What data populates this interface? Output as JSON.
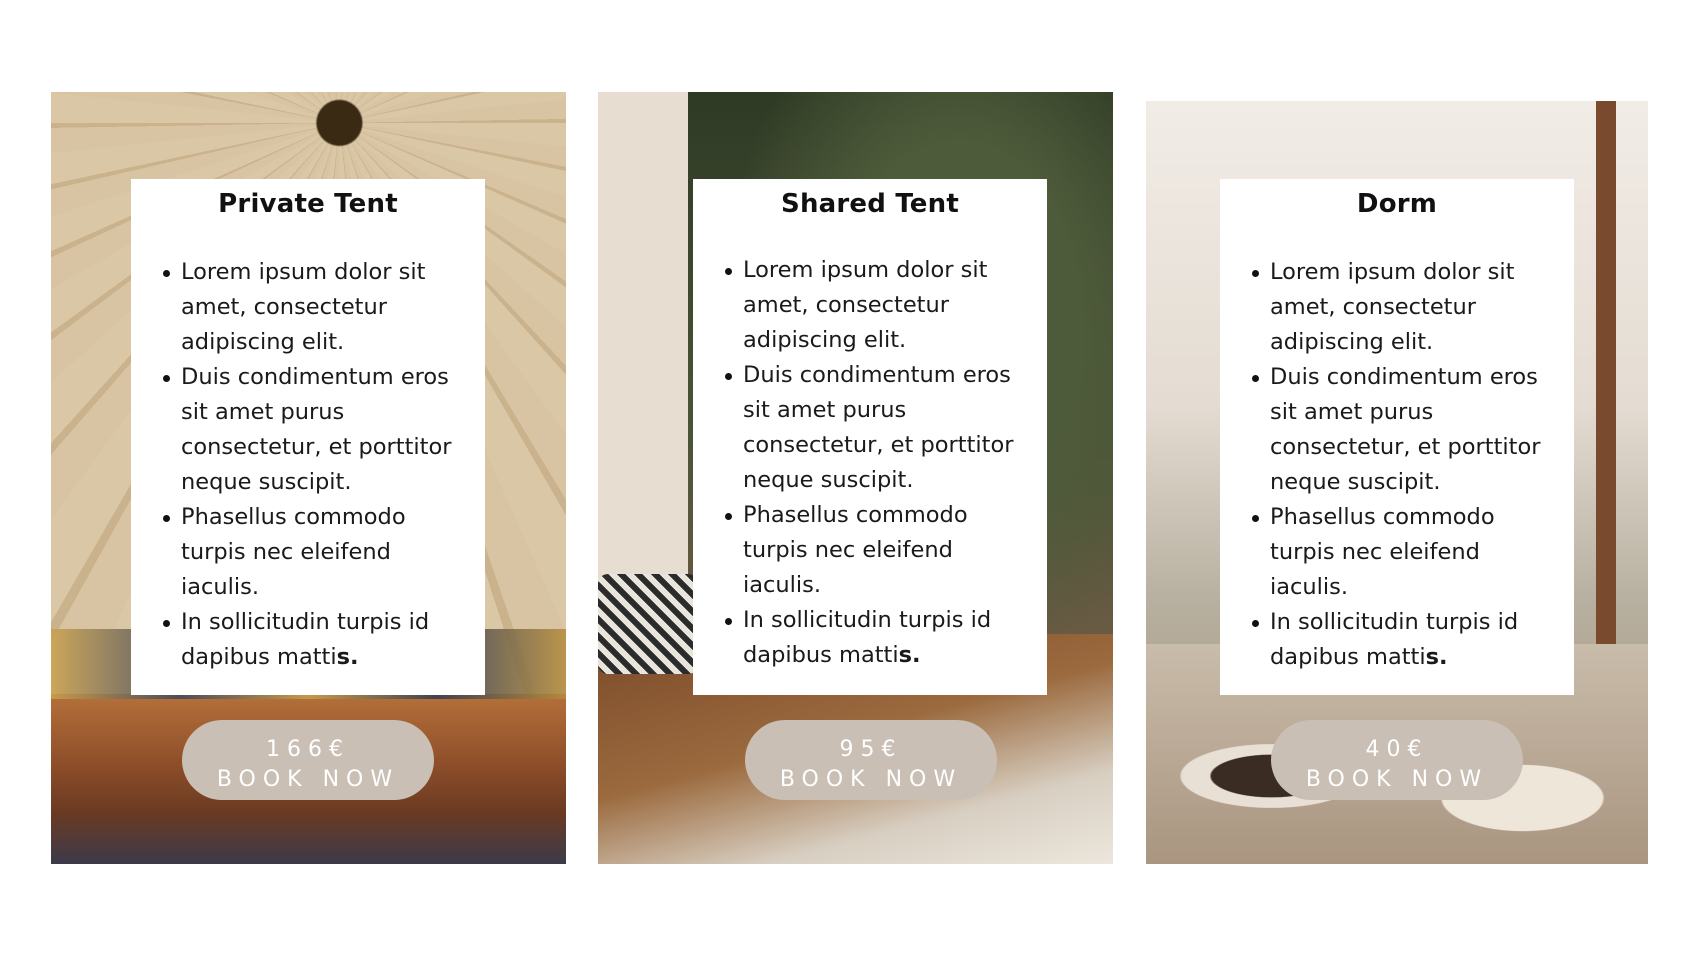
{
  "cards": [
    {
      "title": "Private Tent",
      "features": [
        "Lorem ipsum dolor sit amet, consectetur adipiscing elit.",
        "Duis condimentum eros sit amet purus consectetur, et porttitor neque suscipit.",
        "Phasellus commodo turpis nec eleifend iaculis."
      ],
      "last_feature_text": "In sollicitudin turpis id dapibus matti",
      "last_feature_bold": "s.",
      "price": "166€",
      "cta": "BOOK NOW"
    },
    {
      "title": "Shared Tent",
      "features": [
        "Lorem ipsum dolor sit amet, consectetur adipiscing elit.",
        "Duis condimentum eros sit amet purus consectetur, et porttitor neque suscipit.",
        "Phasellus commodo turpis nec eleifend iaculis."
      ],
      "last_feature_text": "In sollicitudin turpis id dapibus matti",
      "last_feature_bold": "s.",
      "price": "95€",
      "cta": "BOOK NOW"
    },
    {
      "title": "Dorm",
      "features": [
        "Lorem ipsum dolor sit amet, consectetur adipiscing elit.",
        "Duis condimentum eros sit amet purus consectetur, et porttitor neque suscipit.",
        "Phasellus commodo turpis nec eleifend iaculis."
      ],
      "last_feature_text": "In sollicitudin turpis id dapibus matti",
      "last_feature_bold": "s.",
      "price": "40€",
      "cta": "BOOK NOW"
    }
  ],
  "colors": {
    "button_bg": "#c9bfb4",
    "button_text": "#ffffff",
    "panel_bg": "#ffffff",
    "text": "#1a1a1a"
  }
}
